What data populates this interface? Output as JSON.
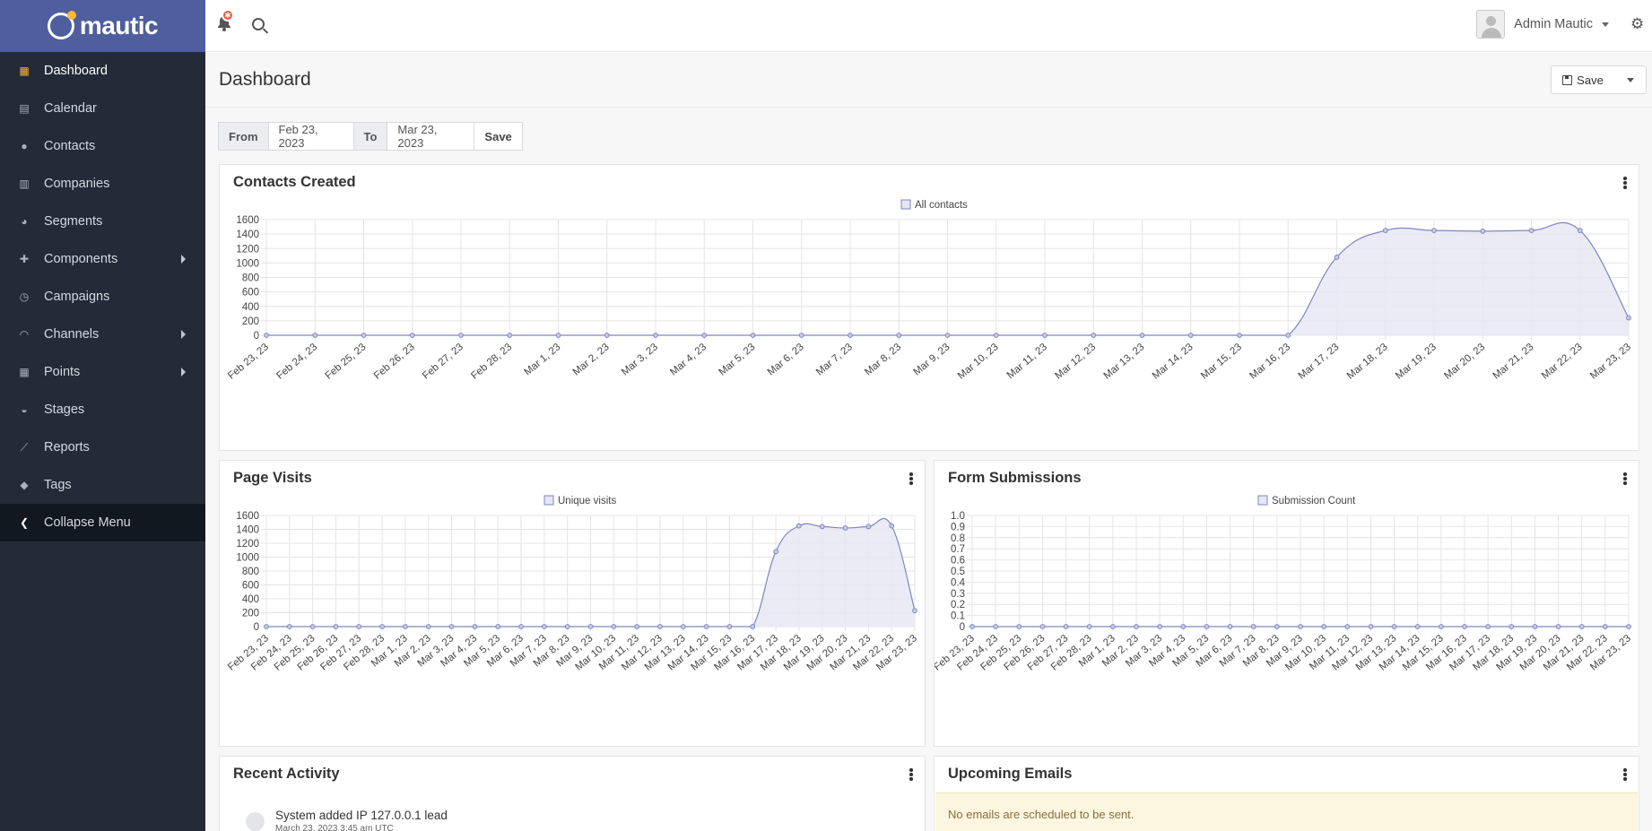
{
  "brand": {
    "name": "mautic"
  },
  "sidebar": {
    "items": [
      {
        "label": "Dashboard",
        "icon": "dashboard-icon",
        "active": true
      },
      {
        "label": "Calendar",
        "icon": "calendar-icon"
      },
      {
        "label": "Contacts",
        "icon": "user-icon"
      },
      {
        "label": "Companies",
        "icon": "building-icon"
      },
      {
        "label": "Segments",
        "icon": "pie-chart-icon"
      },
      {
        "label": "Components",
        "icon": "puzzle-icon",
        "submenu": true
      },
      {
        "label": "Campaigns",
        "icon": "clock-icon"
      },
      {
        "label": "Channels",
        "icon": "rss-icon",
        "submenu": true
      },
      {
        "label": "Points",
        "icon": "calculator-icon",
        "submenu": true
      },
      {
        "label": "Stages",
        "icon": "tachometer-icon"
      },
      {
        "label": "Reports",
        "icon": "line-chart-icon"
      },
      {
        "label": "Tags",
        "icon": "tag-icon"
      }
    ],
    "collapse_label": "Collapse Menu"
  },
  "topbar": {
    "notification_badge": "✱",
    "user_name": "Admin Mautic"
  },
  "page": {
    "title": "Dashboard",
    "save_label": "Save"
  },
  "daterange": {
    "from_label": "From",
    "from_value": "Feb 23, 2023",
    "to_label": "To",
    "to_value": "Mar 23, 2023",
    "save_label": "Save"
  },
  "colors": {
    "accent": "#4e5e9e",
    "sidebar": "#222b37",
    "line": "#7d86c2",
    "fill": "#e6e7f3"
  },
  "dates": [
    "Feb 23, 23",
    "Feb 24, 23",
    "Feb 25, 23",
    "Feb 26, 23",
    "Feb 27, 23",
    "Feb 28, 23",
    "Mar 1, 23",
    "Mar 2, 23",
    "Mar 3, 23",
    "Mar 4, 23",
    "Mar 5, 23",
    "Mar 6, 23",
    "Mar 7, 23",
    "Mar 8, 23",
    "Mar 9, 23",
    "Mar 10, 23",
    "Mar 11, 23",
    "Mar 12, 23",
    "Mar 13, 23",
    "Mar 14, 23",
    "Mar 15, 23",
    "Mar 16, 23",
    "Mar 17, 23",
    "Mar 18, 23",
    "Mar 19, 23",
    "Mar 20, 23",
    "Mar 21, 23",
    "Mar 22, 23",
    "Mar 23, 23"
  ],
  "panels": {
    "contacts": {
      "title": "Contacts Created"
    },
    "visits": {
      "title": "Page Visits"
    },
    "forms": {
      "title": "Form Submissions"
    },
    "activity": {
      "title": "Recent Activity",
      "items": [
        {
          "text": "System added IP 127.0.0.1 lead",
          "time": "March 23, 2023 3:45 am UTC"
        }
      ]
    },
    "emails": {
      "title": "Upcoming Emails",
      "notice": "No emails are scheduled to be sent."
    }
  },
  "chart_data": [
    {
      "type": "line",
      "title": "Contacts Created",
      "x": [
        "Feb 23, 23",
        "Feb 24, 23",
        "Feb 25, 23",
        "Feb 26, 23",
        "Feb 27, 23",
        "Feb 28, 23",
        "Mar 1, 23",
        "Mar 2, 23",
        "Mar 3, 23",
        "Mar 4, 23",
        "Mar 5, 23",
        "Mar 6, 23",
        "Mar 7, 23",
        "Mar 8, 23",
        "Mar 9, 23",
        "Mar 10, 23",
        "Mar 11, 23",
        "Mar 12, 23",
        "Mar 13, 23",
        "Mar 14, 23",
        "Mar 15, 23",
        "Mar 16, 23",
        "Mar 17, 23",
        "Mar 18, 23",
        "Mar 19, 23",
        "Mar 20, 23",
        "Mar 21, 23",
        "Mar 22, 23",
        "Mar 23, 23"
      ],
      "series": [
        {
          "name": "All contacts",
          "values": [
            0,
            0,
            0,
            0,
            0,
            0,
            0,
            0,
            0,
            0,
            0,
            0,
            0,
            0,
            0,
            0,
            0,
            0,
            0,
            0,
            0,
            0,
            1080,
            1450,
            1450,
            1440,
            1450,
            1450,
            240
          ]
        }
      ],
      "yticks": [
        "0",
        "200",
        "400",
        "600",
        "800",
        "1000",
        "1200",
        "1400",
        "1600"
      ],
      "ylim": [
        0,
        1600
      ],
      "legend": "top-center",
      "grid": true
    },
    {
      "type": "line",
      "title": "Page Visits",
      "x": [
        "Feb 23, 23",
        "Feb 24, 23",
        "Feb 25, 23",
        "Feb 26, 23",
        "Feb 27, 23",
        "Feb 28, 23",
        "Mar 1, 23",
        "Mar 2, 23",
        "Mar 3, 23",
        "Mar 4, 23",
        "Mar 5, 23",
        "Mar 6, 23",
        "Mar 7, 23",
        "Mar 8, 23",
        "Mar 9, 23",
        "Mar 10, 23",
        "Mar 11, 23",
        "Mar 12, 23",
        "Mar 13, 23",
        "Mar 14, 23",
        "Mar 15, 23",
        "Mar 16, 23",
        "Mar 17, 23",
        "Mar 18, 23",
        "Mar 19, 23",
        "Mar 20, 23",
        "Mar 21, 23",
        "Mar 22, 23",
        "Mar 23, 23"
      ],
      "series": [
        {
          "name": "Unique visits",
          "values": [
            0,
            0,
            0,
            0,
            0,
            0,
            0,
            0,
            0,
            0,
            0,
            0,
            0,
            0,
            0,
            0,
            0,
            0,
            0,
            0,
            0,
            0,
            1080,
            1450,
            1440,
            1420,
            1440,
            1450,
            230
          ]
        }
      ],
      "yticks": [
        "0",
        "200",
        "400",
        "600",
        "800",
        "1000",
        "1200",
        "1400",
        "1600"
      ],
      "ylim": [
        0,
        1600
      ],
      "legend": "top-center",
      "grid": true
    },
    {
      "type": "line",
      "title": "Form Submissions",
      "x": [
        "Feb 23, 23",
        "Feb 24, 23",
        "Feb 25, 23",
        "Feb 26, 23",
        "Feb 27, 23",
        "Feb 28, 23",
        "Mar 1, 23",
        "Mar 2, 23",
        "Mar 3, 23",
        "Mar 4, 23",
        "Mar 5, 23",
        "Mar 6, 23",
        "Mar 7, 23",
        "Mar 8, 23",
        "Mar 9, 23",
        "Mar 10, 23",
        "Mar 11, 23",
        "Mar 12, 23",
        "Mar 13, 23",
        "Mar 14, 23",
        "Mar 15, 23",
        "Mar 16, 23",
        "Mar 17, 23",
        "Mar 18, 23",
        "Mar 19, 23",
        "Mar 20, 23",
        "Mar 21, 23",
        "Mar 22, 23",
        "Mar 23, 23"
      ],
      "series": [
        {
          "name": "Submission Count",
          "values": [
            0,
            0,
            0,
            0,
            0,
            0,
            0,
            0,
            0,
            0,
            0,
            0,
            0,
            0,
            0,
            0,
            0,
            0,
            0,
            0,
            0,
            0,
            0,
            0,
            0,
            0,
            0,
            0,
            0
          ]
        }
      ],
      "yticks": [
        "0",
        "0.1",
        "0.2",
        "0.3",
        "0.4",
        "0.5",
        "0.6",
        "0.7",
        "0.8",
        "0.9",
        "1.0"
      ],
      "ylim": [
        0,
        1
      ],
      "legend": "top-center",
      "grid": true
    }
  ]
}
